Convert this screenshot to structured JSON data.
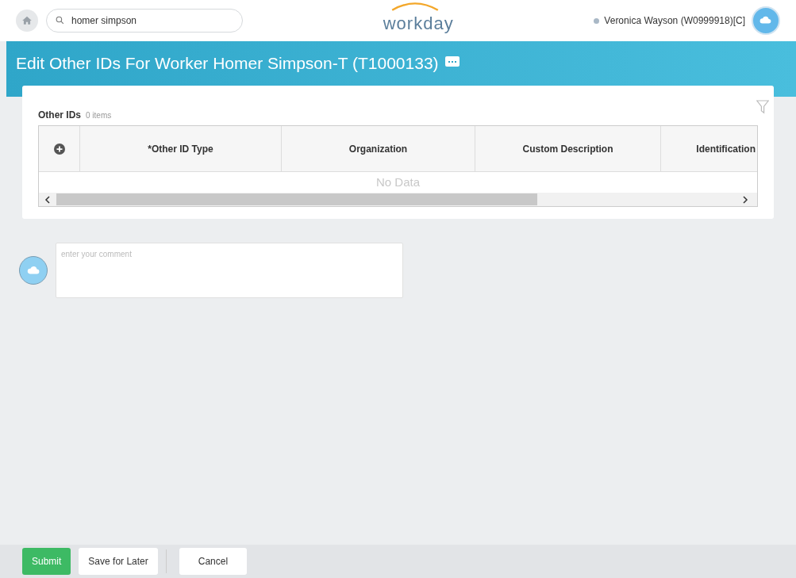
{
  "header": {
    "search": {
      "value": "homer simpson"
    },
    "logo": "workday",
    "user": "Veronica Wayson (W0999918)[C]"
  },
  "banner": {
    "title": "Edit Other IDs For Worker  Homer Simpson-T (T1000133)"
  },
  "grid": {
    "title": "Other IDs",
    "count": "0 items",
    "columns": [
      "*Other ID Type",
      "Organization",
      "Custom Description",
      "Identification"
    ],
    "empty": "No Data"
  },
  "comment": {
    "placeholder": "enter your comment"
  },
  "footer": {
    "buttons": [
      {
        "label": "Submit",
        "kind": "primary"
      },
      {
        "label": "Save for Later",
        "kind": "secondary"
      },
      {
        "label": "Cancel",
        "kind": "secondary"
      }
    ]
  }
}
